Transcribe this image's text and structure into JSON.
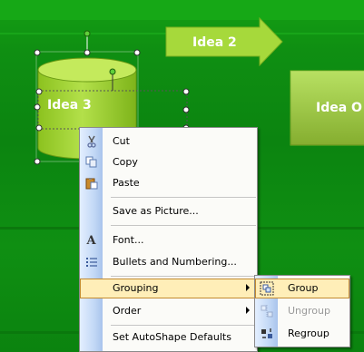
{
  "slide": {
    "shapes": [
      {
        "label": "Idea 3"
      },
      {
        "label": "Idea 2"
      },
      {
        "label": "Idea O"
      }
    ]
  },
  "context_menu": {
    "items": [
      {
        "label": "Cut",
        "icon": "scissors-icon"
      },
      {
        "label": "Copy",
        "icon": "copy-icon"
      },
      {
        "label": "Paste",
        "icon": "paste-icon"
      },
      {
        "label": "Save as Picture..."
      },
      {
        "label": "Font...",
        "icon": "font-icon"
      },
      {
        "label": "Bullets and Numbering...",
        "icon": "bullets-icon"
      },
      {
        "label": "Grouping",
        "has_submenu": true,
        "highlighted": true
      },
      {
        "label": "Order",
        "has_submenu": true
      },
      {
        "label": "Set AutoShape Defaults"
      }
    ]
  },
  "submenu": {
    "items": [
      {
        "label": "Group",
        "icon": "group-icon",
        "highlighted": true
      },
      {
        "label": "Ungroup",
        "icon": "ungroup-icon",
        "disabled": true
      },
      {
        "label": "Regroup",
        "icon": "regroup-icon"
      }
    ]
  },
  "colors": {
    "slide_bg": "#0e8c10",
    "shape_fill": "#9acd32",
    "menu_highlight": "#ffeeb8"
  }
}
